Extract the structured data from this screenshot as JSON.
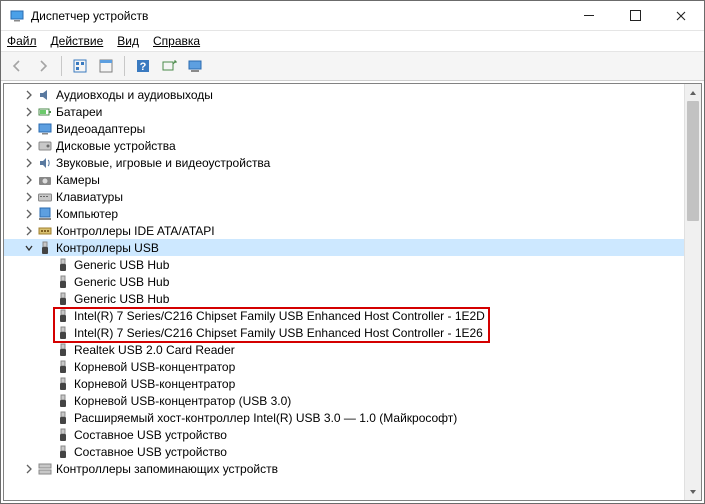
{
  "window": {
    "title": "Диспетчер устройств"
  },
  "menu": {
    "file": "Файл",
    "action": "Действие",
    "view": "Вид",
    "help": "Справка"
  },
  "tree": {
    "categories": [
      {
        "label": "Аудиовходы и аудиовыходы",
        "icon": "audio"
      },
      {
        "label": "Батареи",
        "icon": "battery"
      },
      {
        "label": "Видеоадаптеры",
        "icon": "display"
      },
      {
        "label": "Дисковые устройства",
        "icon": "disk"
      },
      {
        "label": "Звуковые, игровые и видеоустройства",
        "icon": "sound"
      },
      {
        "label": "Камеры",
        "icon": "camera"
      },
      {
        "label": "Клавиатуры",
        "icon": "keyboard"
      },
      {
        "label": "Компьютер",
        "icon": "computer"
      },
      {
        "label": "Контроллеры IDE ATA/ATAPI",
        "icon": "ide"
      },
      {
        "label": "Контроллеры USB",
        "icon": "usb",
        "expanded": true,
        "selected": true
      },
      {
        "label": "Контроллеры запоминающих устройств",
        "icon": "storage"
      }
    ],
    "usb_children": [
      {
        "label": "Generic USB Hub"
      },
      {
        "label": "Generic USB Hub"
      },
      {
        "label": "Generic USB Hub"
      },
      {
        "label": "Intel(R) 7 Series/C216 Chipset Family USB Enhanced Host Controller - 1E2D",
        "highlighted": true
      },
      {
        "label": "Intel(R) 7 Series/C216 Chipset Family USB Enhanced Host Controller - 1E26",
        "highlighted": true
      },
      {
        "label": "Realtek USB 2.0 Card Reader"
      },
      {
        "label": "Корневой USB-концентратор"
      },
      {
        "label": "Корневой USB-концентратор"
      },
      {
        "label": "Корневой USB-концентратор (USB 3.0)"
      },
      {
        "label": "Расширяемый хост-контроллер Intel(R) USB 3.0 — 1.0 (Майкрософт)"
      },
      {
        "label": "Составное USB устройство"
      },
      {
        "label": "Составное USB устройство"
      }
    ]
  }
}
